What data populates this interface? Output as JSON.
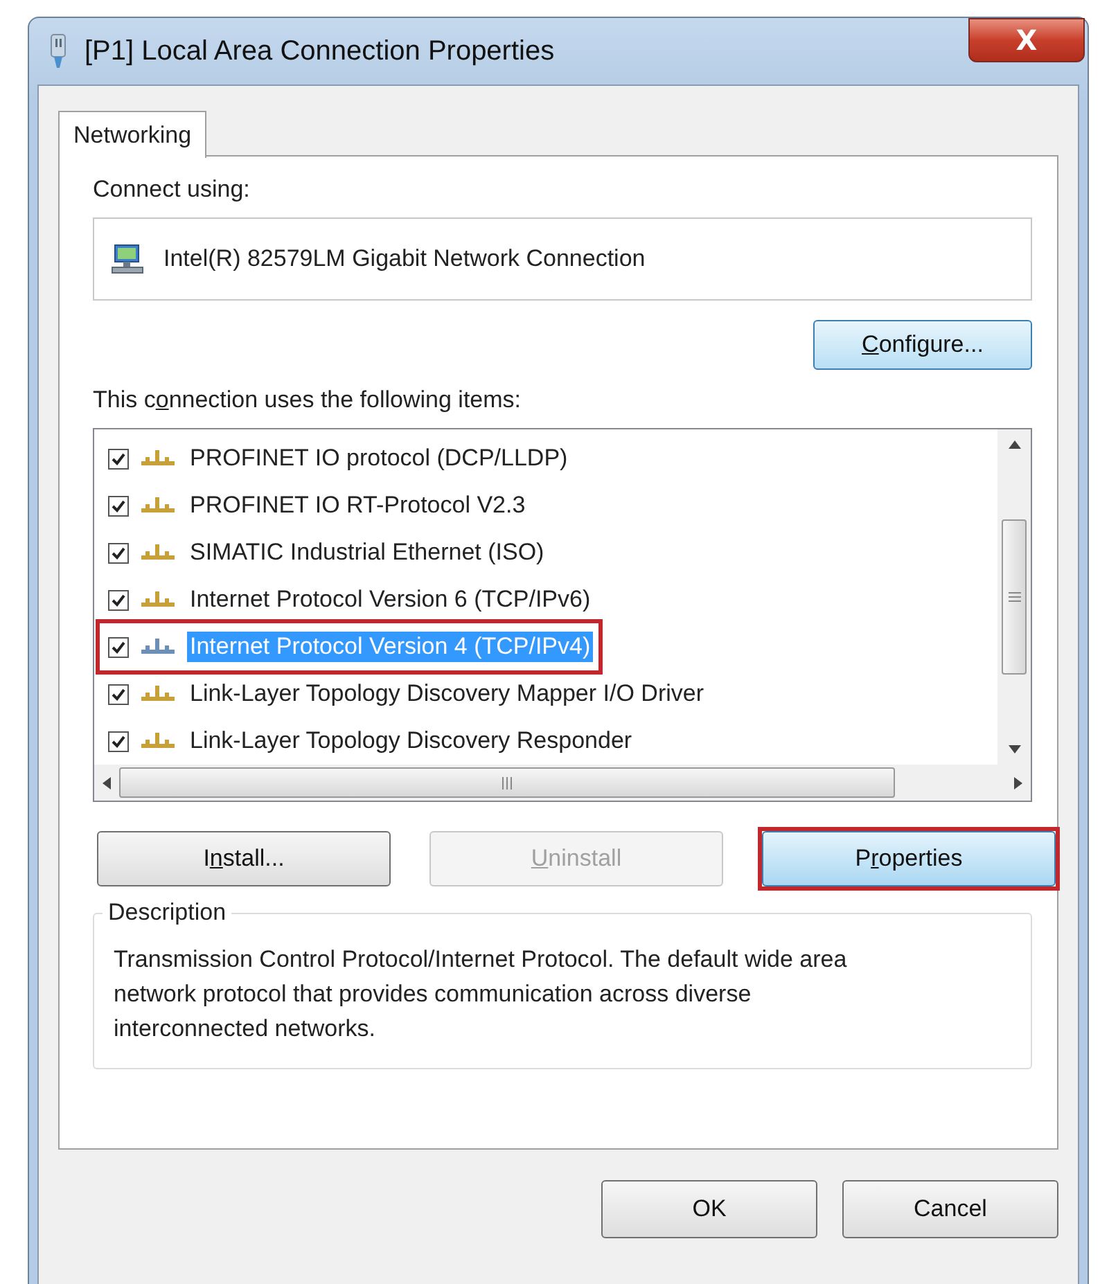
{
  "window": {
    "title": "[P1] Local Area Connection Properties",
    "close": "X"
  },
  "tabs": [
    {
      "label": "Networking",
      "selected": true
    }
  ],
  "connect_using": {
    "label": "Connect using:",
    "adapter": "Intel(R) 82579LM Gigabit Network Connection"
  },
  "configure_button": {
    "key": "C",
    "after": "onfigure..."
  },
  "items_label": {
    "before": "This c",
    "key": "o",
    "after": "nnection uses the following items:"
  },
  "items": [
    {
      "label": "PROFINET IO protocol (DCP/LLDP)",
      "checked": true,
      "selected": false,
      "highlighted": false
    },
    {
      "label": "PROFINET IO RT-Protocol V2.3",
      "checked": true,
      "selected": false,
      "highlighted": false
    },
    {
      "label": "SIMATIC Industrial Ethernet (ISO)",
      "checked": true,
      "selected": false,
      "highlighted": false
    },
    {
      "label": "Internet Protocol Version 6 (TCP/IPv6)",
      "checked": true,
      "selected": false,
      "highlighted": false
    },
    {
      "label": "Internet Protocol Version 4 (TCP/IPv4)",
      "checked": true,
      "selected": true,
      "highlighted": true
    },
    {
      "label": "Link-Layer Topology Discovery Mapper I/O Driver",
      "checked": true,
      "selected": false,
      "highlighted": false
    },
    {
      "label": "Link-Layer Topology Discovery Responder",
      "checked": true,
      "selected": false,
      "highlighted": false
    }
  ],
  "item_buttons": [
    {
      "before": "I",
      "key": "n",
      "after": "stall...",
      "disabled": false,
      "focused": false,
      "highlighted": false
    },
    {
      "key": "U",
      "after": "ninstall",
      "disabled": true,
      "focused": false,
      "highlighted": false
    },
    {
      "before": "P",
      "key": "r",
      "after": "operties",
      "disabled": false,
      "focused": true,
      "highlighted": true
    }
  ],
  "description": {
    "title": "Description",
    "text": "Transmission Control Protocol/Internet Protocol. The default wide area network protocol that provides communication across diverse interconnected networks."
  },
  "dialog_buttons": [
    "OK",
    "Cancel"
  ]
}
